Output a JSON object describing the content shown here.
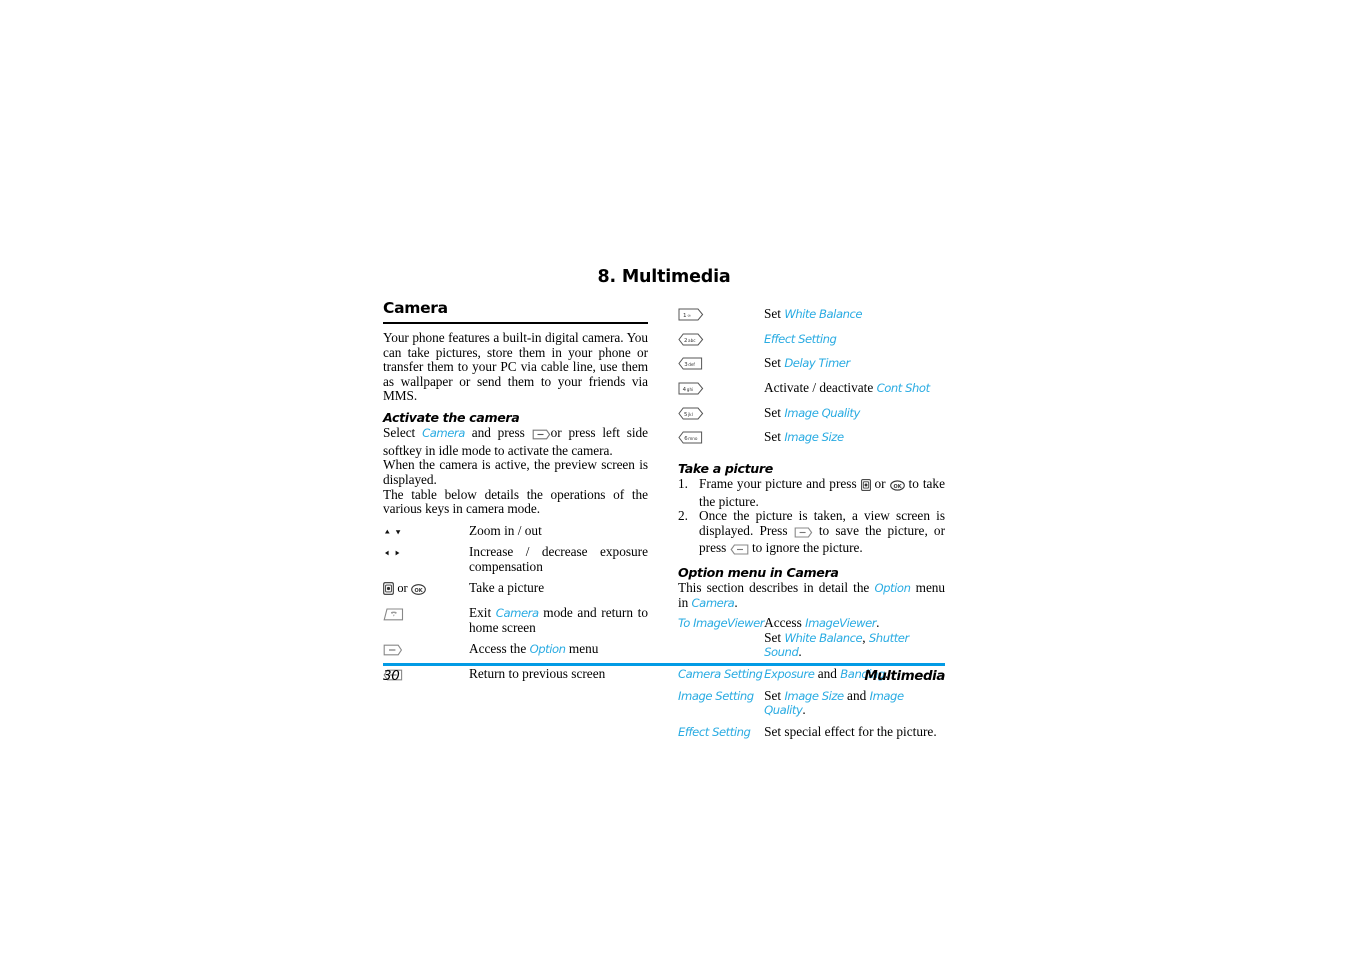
{
  "document": {
    "chapter_title": "8. Multimedia",
    "footer": {
      "page_number": "30",
      "section_name": "Multimedia"
    },
    "accent_color": "#29ABE2",
    "footer_rule_color": "#029BE5"
  },
  "left_column": {
    "section_heading": "Camera",
    "intro_paragraph": "Your phone features a built-in digital camera. You can take pictures, store them in your phone or transfer them to your PC via cable line, use them as wallpaper or send them to your friends via MMS.",
    "activate_heading": "Activate the camera",
    "activate_text": {
      "p1_a": "Select ",
      "p1_link": "Camera",
      "p1_b": " and press ",
      "p1_c": "or press left side softkey in idle mode to activate the camera.",
      "p2": "When the camera is active, the preview screen is displayed.",
      "p3": "The table below details the operations of the various keys in camera mode."
    },
    "key_table": [
      {
        "key_icon": "nav-up-down-icon",
        "key_label": "",
        "description": "Zoom in / out"
      },
      {
        "key_icon": "nav-left-right-icon",
        "key_label": "",
        "description": "Increase / decrease exposure compensation"
      },
      {
        "key_icon": "camera-key-or-ok-key-icon",
        "key_label": "or",
        "description": "Take a picture"
      },
      {
        "key_icon": "end-call-key-icon",
        "key_label": "",
        "description_a": "Exit ",
        "description_link": "Camera",
        "description_b": " mode and return to home screen"
      },
      {
        "key_icon": "left-softkey-icon",
        "key_label": "",
        "description_a": "Access the ",
        "description_link": "Option",
        "description_b": " menu"
      },
      {
        "key_icon": "right-softkey-icon",
        "key_label": "",
        "description": "Return to previous screen"
      }
    ]
  },
  "right_column": {
    "numeric_key_table": [
      {
        "key_icon": "keypad-key-1-icon",
        "key_digit": "1",
        "key_letters": "∞",
        "prefix": "Set ",
        "link": "White Balance",
        "suffix": ""
      },
      {
        "key_icon": "keypad-key-2-icon",
        "key_digit": "2",
        "key_letters": "abc",
        "prefix": "",
        "link": "Effect Setting",
        "suffix": ""
      },
      {
        "key_icon": "keypad-key-3-icon",
        "key_digit": "3",
        "key_letters": "def",
        "prefix": "Set ",
        "link": "Delay Timer",
        "suffix": ""
      },
      {
        "key_icon": "keypad-key-4-icon",
        "key_digit": "4",
        "key_letters": "ghi",
        "prefix": "Activate / deactivate ",
        "link": "Cont Shot",
        "suffix": ""
      },
      {
        "key_icon": "keypad-key-5-icon",
        "key_digit": "5",
        "key_letters": "jkl",
        "prefix": "Set ",
        "link": "Image Quality",
        "suffix": ""
      },
      {
        "key_icon": "keypad-key-6-icon",
        "key_digit": "6",
        "key_letters": "mno",
        "prefix": "Set ",
        "link": "Image Size",
        "suffix": ""
      }
    ],
    "take_picture_heading": "Take a picture",
    "take_picture_steps": {
      "step1_a": "Frame your picture and press ",
      "step1_b": " or ",
      "step1_c": " to take the picture.",
      "step2_a": "Once the picture is taken, a view screen is displayed. Press ",
      "step2_b": " to save the picture, or press ",
      "step2_c": " to ignore the picture."
    },
    "option_menu_heading": "Option menu in Camera",
    "option_menu_intro": {
      "a": "This section describes in detail the ",
      "link1": "Option",
      "b": " menu in ",
      "link2": "Camera",
      "c": "."
    },
    "option_table": [
      {
        "menu_item": "To ImageViewer",
        "lines": [
          {
            "prefix": "Access ",
            "link": "ImageViewer",
            "suffix": "."
          },
          {
            "prefix": "Set ",
            "link": "White Balance",
            "mid": ", ",
            "link2": "Shutter Sound",
            "suffix": "."
          }
        ]
      },
      {
        "menu_item": "Camera Setting",
        "lines": [
          {
            "prefix": "",
            "link": "Exposure",
            "mid": " and ",
            "link2": "Banding",
            "suffix": "."
          }
        ]
      },
      {
        "menu_item": "Image Setting",
        "lines": [
          {
            "prefix": "Set ",
            "link": "Image Size",
            "mid": " and ",
            "link2": "Image Quality",
            "suffix": "."
          }
        ]
      },
      {
        "menu_item": "Effect Setting",
        "lines": [
          {
            "prefix": "Set special effect for the picture.",
            "link": "",
            "suffix": ""
          }
        ]
      }
    ]
  }
}
